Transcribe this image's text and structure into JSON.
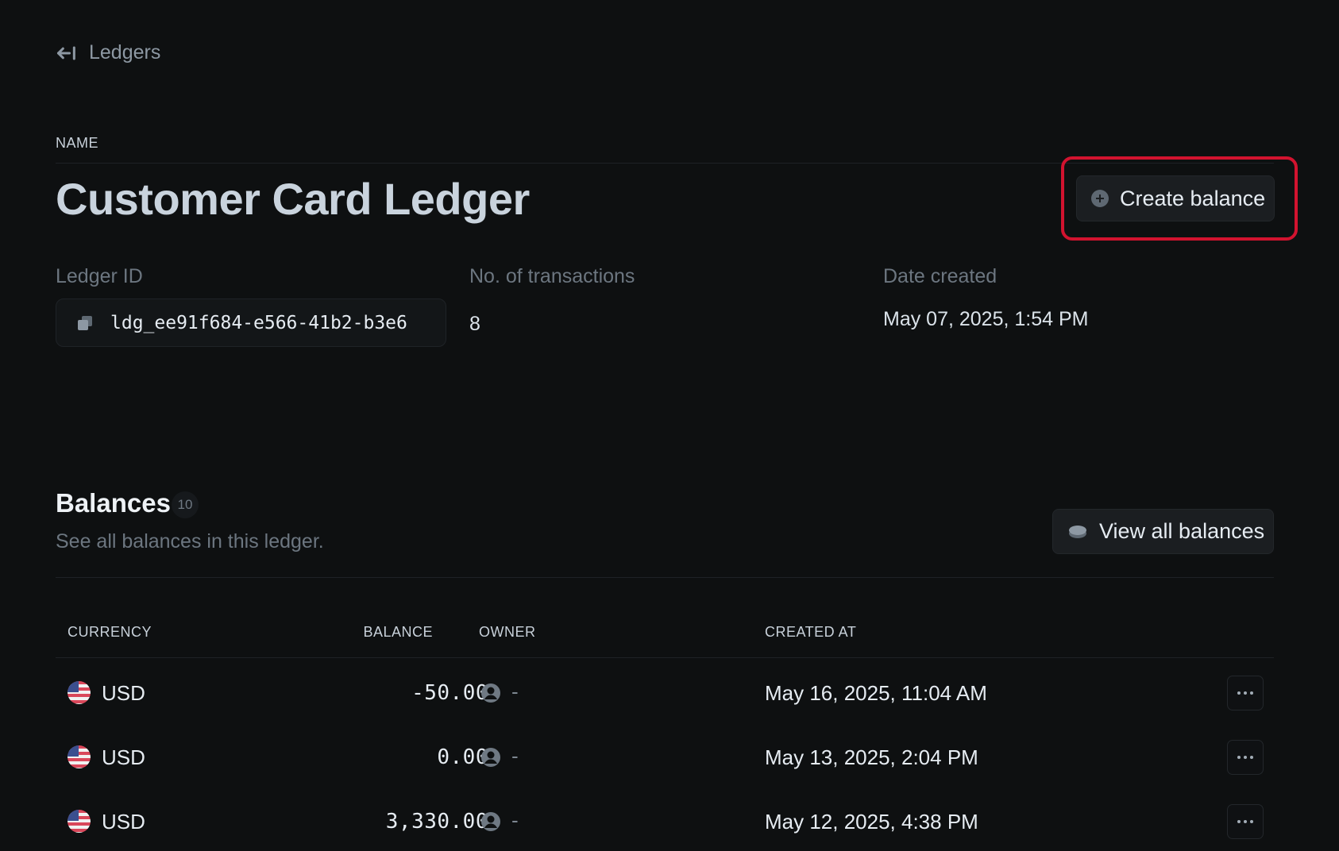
{
  "nav": {
    "back_label": "Ledgers"
  },
  "header": {
    "name_label": "NAME",
    "title": "Customer Card Ledger",
    "create_balance_label": "Create balance"
  },
  "meta": {
    "ledger_id_label": "Ledger ID",
    "ledger_id_value": "ldg_ee91f684-e566-41b2-b3e6",
    "transactions_label": "No. of transactions",
    "transactions_value": "8",
    "date_created_label": "Date created",
    "date_created_value": "May 07, 2025, 1:54 PM"
  },
  "balances": {
    "title": "Balances",
    "count": "10",
    "subtitle": "See all balances in this ledger.",
    "view_all_label": "View all balances",
    "columns": [
      "CURRENCY",
      "BALANCE",
      "OWNER",
      "CREATED AT"
    ],
    "rows": [
      {
        "currency": "USD",
        "balance": "-50.00",
        "owner": "-",
        "created_at": "May 16, 2025, 11:04 AM"
      },
      {
        "currency": "USD",
        "balance": "0.00",
        "owner": "-",
        "created_at": "May 13, 2025, 2:04 PM"
      },
      {
        "currency": "USD",
        "balance": "3,330.00",
        "owner": "-",
        "created_at": "May 12, 2025, 4:38 PM"
      }
    ]
  },
  "colors": {
    "background": "#0e1011",
    "highlight": "#d2132f",
    "muted_text": "#6c7680"
  },
  "icons": {
    "back": "arrow-left-to-line-icon",
    "create": "plus-circle-icon",
    "copy": "copy-icon",
    "view_all": "coins-icon",
    "flag": "us-flag-icon",
    "owner": "user-circle-icon",
    "more": "ellipsis-icon"
  }
}
